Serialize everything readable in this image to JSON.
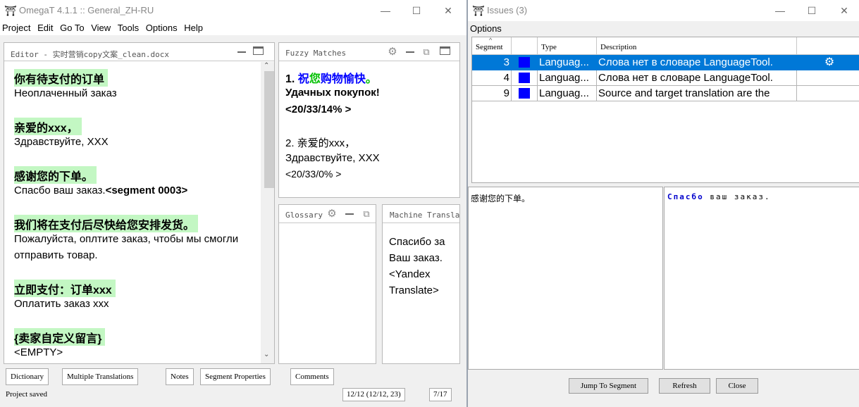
{
  "left_window": {
    "title": "OmegaT 4.1.1 :: General_ZH-RU",
    "controls": {
      "minimize": "—",
      "maximize": "☐",
      "close": "✕"
    },
    "menu": [
      "Project",
      "Edit",
      "Go To",
      "View",
      "Tools",
      "Options",
      "Help"
    ],
    "editor": {
      "title": "Editor - 实时营销copy文案_clean.docx",
      "segments": [
        {
          "source": "你有待支付的订单",
          "target": [
            "Неоплаченный заказ"
          ]
        },
        {
          "source": "亲爱的xxx，",
          "target": [
            "Здравствуйте, XXX"
          ]
        },
        {
          "source": "感谢您的下单。",
          "target_prefix": "Спасбо ваш заказ.",
          "target_tag": "<segment 0003>"
        },
        {
          "source": "我们将在支付后尽快给您安排发货。",
          "target": [
            "Пожалуйста, оплтите заказ, чтобы мы смогли",
            "отправить товар."
          ]
        },
        {
          "source": "立即支付：订单xxx",
          "target": [
            "Оплатить заказ xxx"
          ]
        },
        {
          "source": "{卖家自定义留言}",
          "target": [
            "<EMPTY>"
          ]
        }
      ]
    },
    "fuzzy": {
      "title": "Fuzzy Matches",
      "m1_num": "1.",
      "m1_a": "祝",
      "m1_b": "您",
      "m1_c": "购物愉快",
      "m1_d": "。",
      "m1_target": "Удачных покупок!",
      "m1_score": "<20/33/14% >",
      "m2_source": "2. 亲爱的xxx，",
      "m2_target": "Здравствуйте, XXX",
      "m2_score": "<20/33/0% >"
    },
    "glossary": {
      "title": "Glossary"
    },
    "machine": {
      "title": "Machine Translati",
      "lines": [
        "Спасибо за",
        "Ваш заказ.",
        "<Yandex",
        "Translate>"
      ]
    },
    "tabs": [
      "Dictionary",
      "Multiple Translations",
      "Notes",
      "Segment Properties",
      "Comments"
    ],
    "status": {
      "message": "Project saved",
      "progress": "12/12 (12/12, 23)",
      "position": "7/17"
    }
  },
  "right_window": {
    "title": "Issues (3)",
    "controls": {
      "minimize": "—",
      "maximize": "☐",
      "close": "✕"
    },
    "menu": [
      "Options"
    ],
    "table": {
      "headers": [
        "Segment",
        "",
        "Type",
        "Description"
      ],
      "rows": [
        {
          "segment": "3",
          "type": "Languag...",
          "description": "Слова нет в словаре LanguageTool."
        },
        {
          "segment": "4",
          "type": "Languag...",
          "description": "Слова нет в словаре LanguageTool."
        },
        {
          "segment": "9",
          "type": "Languag...",
          "description": "Source and target translation are the"
        }
      ]
    },
    "source_text": "感谢您的下单。",
    "target_highlight": "Спасбо",
    "target_rest": " ваш заказ.",
    "buttons": {
      "jump": "Jump To Segment",
      "refresh": "Refresh",
      "close": "Close"
    }
  },
  "colors": {
    "source_highlight": "#c3f7c3",
    "selection": "#0078d7",
    "issue_marker": "#0000ff"
  }
}
